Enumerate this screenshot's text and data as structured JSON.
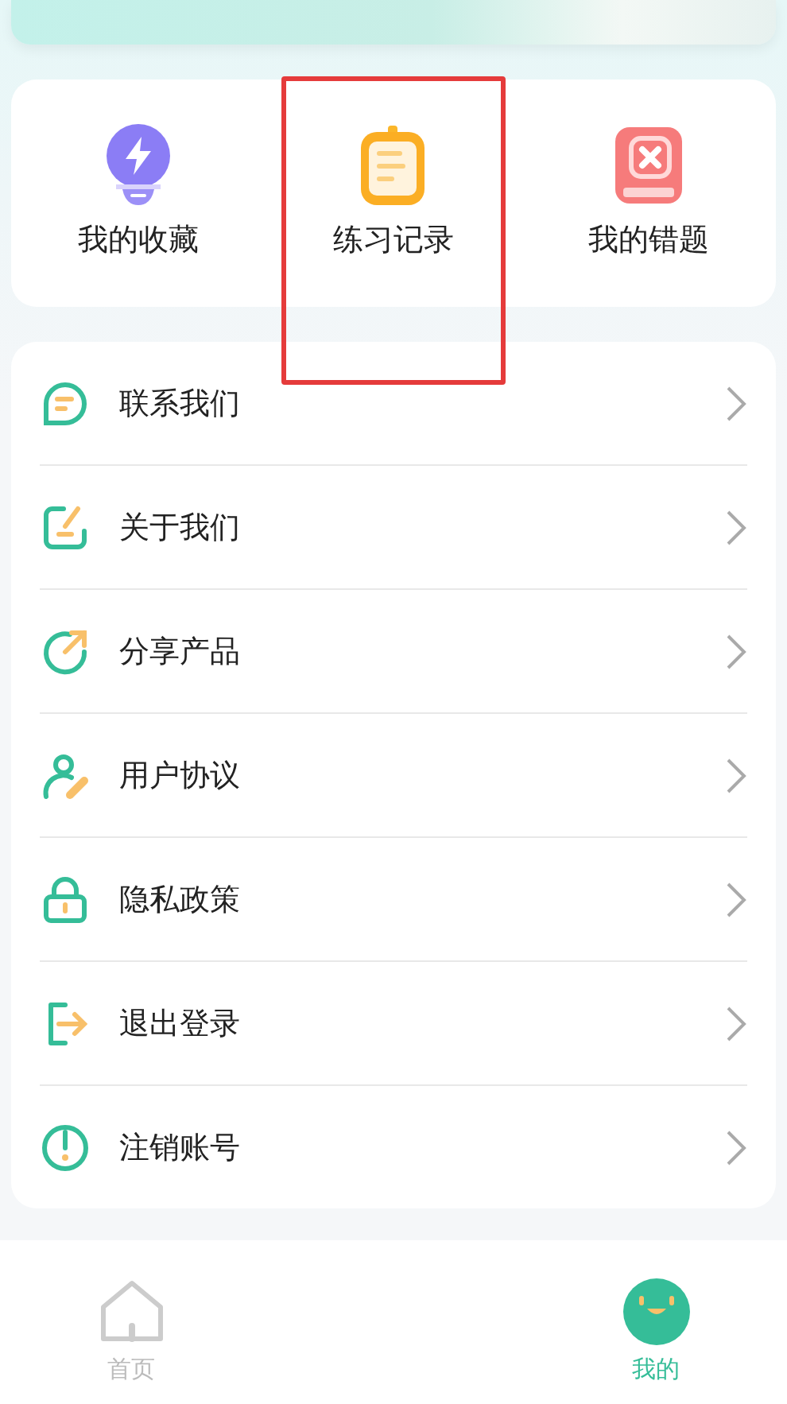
{
  "shortcuts": [
    {
      "label": "我的收藏",
      "kind": "bulb",
      "highlighted": false
    },
    {
      "label": "练习记录",
      "kind": "clipboard",
      "highlighted": true
    },
    {
      "label": "我的错题",
      "kind": "wrongbook",
      "highlighted": false
    }
  ],
  "menu": [
    {
      "label": "联系我们",
      "kind": "chat"
    },
    {
      "label": "关于我们",
      "kind": "edit"
    },
    {
      "label": "分享产品",
      "kind": "share"
    },
    {
      "label": "用户协议",
      "kind": "user"
    },
    {
      "label": "隐私政策",
      "kind": "lock"
    },
    {
      "label": "退出登录",
      "kind": "logout"
    },
    {
      "label": "注销账号",
      "kind": "power"
    }
  ],
  "tab_bar": [
    {
      "label": "首页",
      "kind": "home",
      "selected": false
    },
    {
      "label": "我的",
      "kind": "face",
      "selected": true
    }
  ]
}
